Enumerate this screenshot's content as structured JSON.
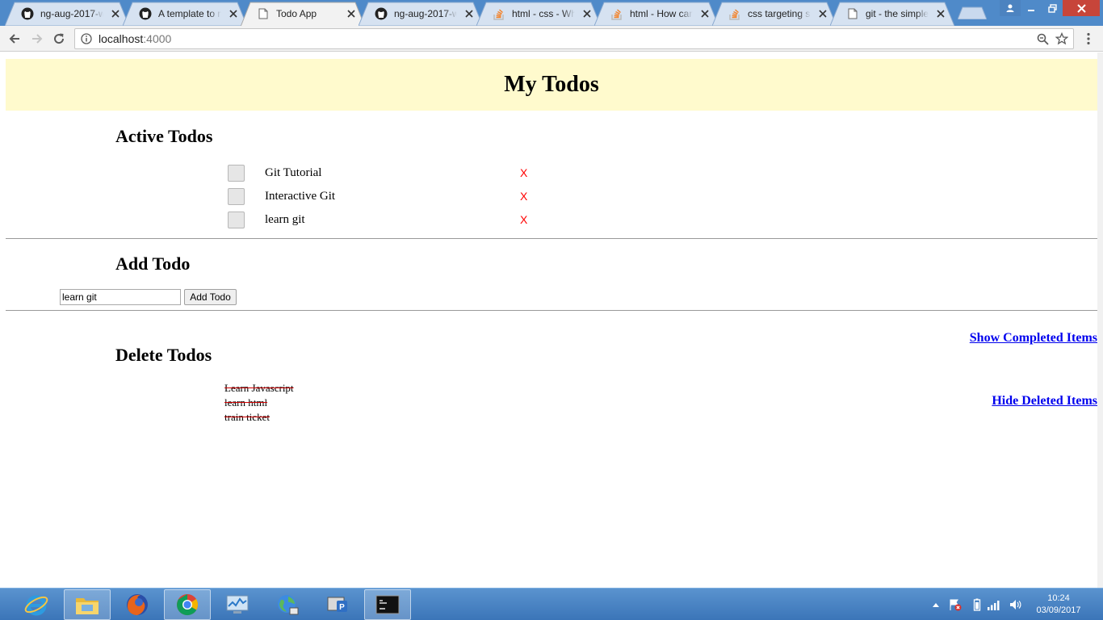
{
  "browser": {
    "tabs": [
      {
        "title": "ng-aug-2017-wo",
        "favicon": "github-icon",
        "active": false
      },
      {
        "title": "A template to m",
        "favicon": "github-icon",
        "active": false
      },
      {
        "title": "Todo App",
        "favicon": "page-icon",
        "active": true
      },
      {
        "title": "ng-aug-2017-wo",
        "favicon": "github-icon",
        "active": false
      },
      {
        "title": "html - css - Why",
        "favicon": "stackoverflow-icon",
        "active": false
      },
      {
        "title": "html - How can",
        "favicon": "stackoverflow-icon",
        "active": false
      },
      {
        "title": "css targeting sp",
        "favicon": "stackoverflow-icon",
        "active": false
      },
      {
        "title": "git - the simple",
        "favicon": "page-icon",
        "active": false
      }
    ],
    "address": {
      "host": "localhost",
      "port": ":4000"
    }
  },
  "page": {
    "title": "My Todos",
    "active_section": {
      "heading": "Active Todos",
      "items": [
        {
          "text": "Git Tutorial",
          "delete_label": "X"
        },
        {
          "text": "Interactive Git",
          "delete_label": "X"
        },
        {
          "text": "learn git",
          "delete_label": "X"
        }
      ]
    },
    "add_section": {
      "heading": "Add Todo",
      "input_value": "learn git",
      "button_label": "Add Todo"
    },
    "show_completed_label": "Show Completed Items",
    "delete_section": {
      "heading": "Delete Todos",
      "items": [
        "Learn Javascript",
        "learn html",
        "train ticket"
      ]
    },
    "hide_deleted_label": "Hide Deleted Items"
  },
  "taskbar": {
    "apps": [
      "internet-explorer-icon",
      "file-explorer-icon",
      "firefox-icon",
      "chrome-icon",
      "task-manager-icon",
      "network-globe-icon",
      "remote-desktop-icon",
      "command-prompt-icon"
    ],
    "time": "10:24",
    "date": "03/09/2017"
  },
  "colors": {
    "header_bg": "#fffacd",
    "delete_x": "#ff0000",
    "link": "#0000ee",
    "tabstrip": "#4f8ac9"
  }
}
